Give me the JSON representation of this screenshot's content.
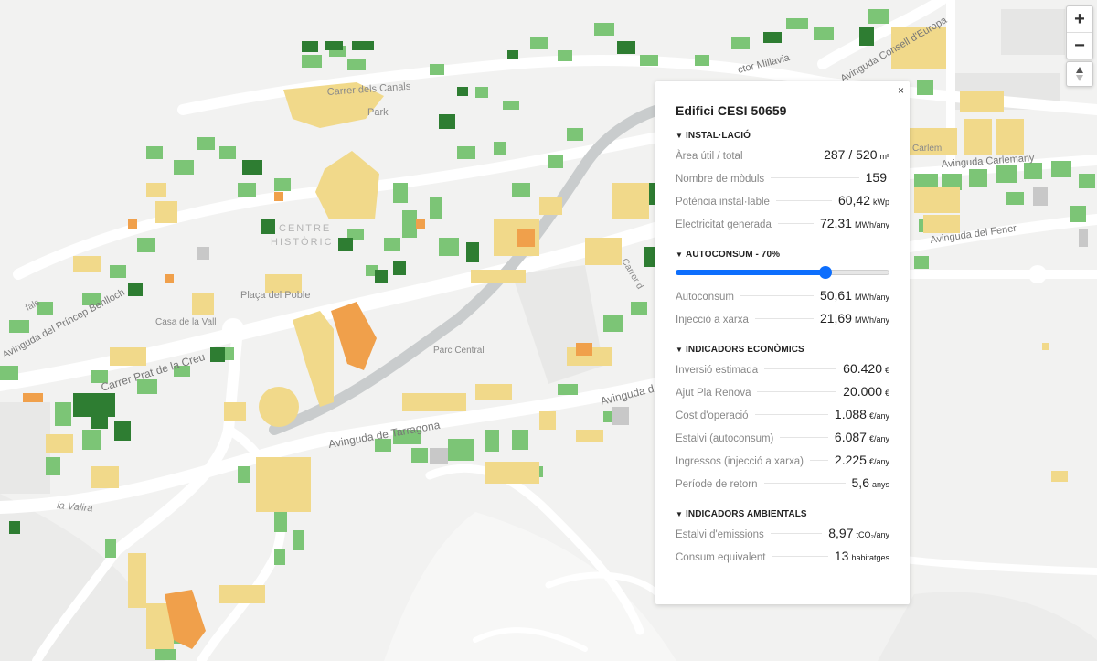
{
  "map": {
    "labels": {
      "carrer_dels_canals": "Carrer dels Canals",
      "park": "Park",
      "centre_historic_1": "CENTRE",
      "centre_historic_2": "HISTÒRIC",
      "placa_del_poble": "Plaça del Poble",
      "casa_de_la_vall": "Casa de la Vall",
      "carrer_prat_de_la_creu": "Carrer Prat de la Creu",
      "parc_central": "Parc Central",
      "avinguda_de_tarragona": "Avinguda de Tarragona",
      "avinguda_d": "Avinguda d",
      "la_valira": "la Valira",
      "avinguda_carlemany": "Avinguda Carlemany",
      "avinguda_del_fener": "Avinguda del Fener",
      "avinguda_consell_deuropa": "Avinguda Consell d'Europa",
      "ctor_millavia": "ctor Millavia",
      "carlem": "Carlem",
      "carrer_de_la_unio": "Carrer de la Unió",
      "avinguda_princep_benlloch": "Avinguda del Príncep Benlloch",
      "carrer_de": "Carrer d",
      "fals": "fals"
    }
  },
  "controls": {
    "zoom_in": "+",
    "zoom_out": "−",
    "compass": "compass-icon"
  },
  "panel": {
    "close": "×",
    "title": "Edifici CESI 50659",
    "installation": {
      "heading": "INSTAL·LACIÓ",
      "rows": [
        {
          "label": "Àrea útil / total",
          "value": "287 / 520",
          "unit": "m²"
        },
        {
          "label": "Nombre de mòduls",
          "value": "159",
          "unit": ""
        },
        {
          "label": "Potència instal·lable",
          "value": "60,42",
          "unit": "kWp"
        },
        {
          "label": "Electricitat generada",
          "value": "72,31",
          "unit": "MWh/any"
        }
      ]
    },
    "selfconsumption": {
      "heading": "AUTOCONSUM - 70%",
      "slider_value": 0.7,
      "rows": [
        {
          "label": "Autoconsum",
          "value": "50,61",
          "unit": "MWh/any"
        },
        {
          "label": "Injecció a xarxa",
          "value": "21,69",
          "unit": "MWh/any"
        }
      ]
    },
    "economic": {
      "heading": "INDICADORS ECONÒMICS",
      "rows": [
        {
          "label": "Inversió estimada",
          "value": "60.420",
          "unit": "€"
        },
        {
          "label": "Ajut Pla Renova",
          "value": "20.000",
          "unit": "€"
        },
        {
          "label": "Cost d'operació",
          "value": "1.088",
          "unit": "€/any"
        },
        {
          "label": "Estalvi (autoconsum)",
          "value": "6.087",
          "unit": "€/any"
        },
        {
          "label": "Ingressos (injecció a xarxa)",
          "value": "2.225",
          "unit": "€/any"
        },
        {
          "label": "Període de retorn",
          "value": "5,6",
          "unit": "anys"
        }
      ]
    },
    "environmental": {
      "heading": "INDICADORS AMBIENTALS",
      "rows": [
        {
          "label": "Estalvi d'emissions",
          "value": "8,97",
          "unit": "tCO₂/any"
        },
        {
          "label": "Consum equivalent",
          "value": "13",
          "unit": "habitatges"
        }
      ]
    }
  },
  "colors": {
    "high": "#2e7d32",
    "mid": "#7cc576",
    "low": "#f1d98a",
    "very_low": "#f0a04b",
    "unknown": "#c8c8c8",
    "accent": "#0d6efd"
  }
}
